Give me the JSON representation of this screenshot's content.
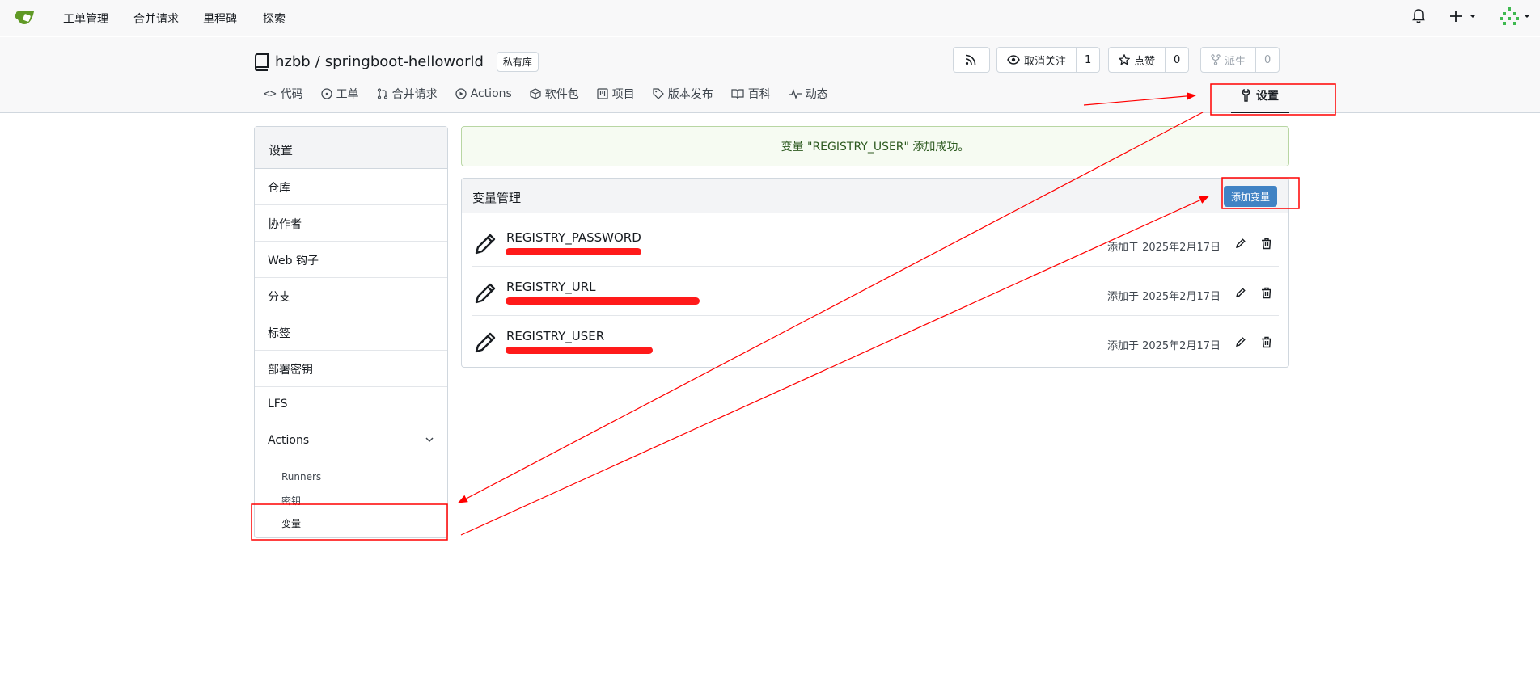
{
  "topnav": {
    "items": [
      "工单管理",
      "合并请求",
      "里程碑",
      "探索"
    ]
  },
  "repo": {
    "owner": "hzbb",
    "separator": "/",
    "name": "springboot-helloworld",
    "private_label": "私有库",
    "watch_label": "取消关注",
    "watch_count": "1",
    "star_label": "点赞",
    "star_count": "0",
    "fork_label": "派生",
    "fork_count": "0"
  },
  "tabs": [
    "代码",
    "工单",
    "合并请求",
    "Actions",
    "软件包",
    "项目",
    "版本发布",
    "百科",
    "动态"
  ],
  "settings_tab": "设置",
  "sidebar": {
    "title": "设置",
    "items": [
      "仓库",
      "协作者",
      "Web 钩子",
      "分支",
      "标签",
      "部署密钥",
      "LFS"
    ],
    "group": "Actions",
    "subitems": [
      "Runners",
      "密钥",
      "变量"
    ]
  },
  "flash": "变量 \"REGISTRY_USER\" 添加成功。",
  "panel": {
    "title": "变量管理",
    "add_button": "添加变量",
    "rows": [
      {
        "name": "REGISTRY_PASSWORD",
        "date": "添加于 2025年2月17日"
      },
      {
        "name": "REGISTRY_URL",
        "date": "添加于 2025年2月17日"
      },
      {
        "name": "REGISTRY_USER",
        "date": "添加于 2025年2月17日"
      }
    ]
  },
  "colors": {
    "accent": "#4183c4",
    "success_bg": "#f6fbf2",
    "annotation": "#ff0000",
    "logo_green": "#609926"
  }
}
